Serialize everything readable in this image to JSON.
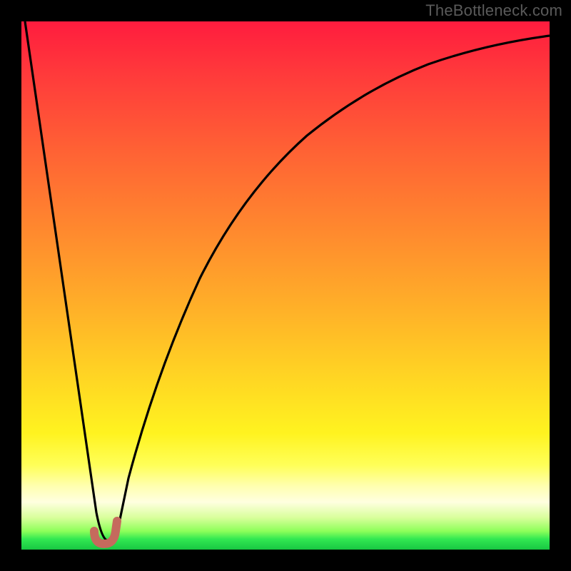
{
  "watermark": "TheBottleneck.com",
  "colors": {
    "background": "#000000",
    "gradient_top": "#ff1c3e",
    "gradient_mid": "#ffd723",
    "gradient_bottom": "#18c742",
    "curve": "#000000",
    "marker": "#c56a5d"
  },
  "chart_data": {
    "type": "line",
    "title": "",
    "xlabel": "",
    "ylabel": "",
    "xlim": [
      0,
      100
    ],
    "ylim": [
      0,
      100
    ],
    "series": [
      {
        "name": "bottleneck-curve",
        "x": [
          0,
          5,
          10,
          14,
          15,
          16,
          17,
          18,
          19,
          20,
          22,
          25,
          30,
          35,
          40,
          45,
          50,
          55,
          60,
          65,
          70,
          75,
          80,
          85,
          90,
          95,
          100
        ],
        "values": [
          100,
          67,
          34,
          7,
          2,
          0.5,
          0.5,
          0.8,
          2,
          5,
          14,
          28,
          46,
          59,
          68,
          75,
          80,
          84,
          87,
          89.5,
          91.5,
          93,
          94.2,
          95.2,
          96,
          96.6,
          97
        ]
      }
    ],
    "marker": {
      "name": "optimal-point",
      "shape": "J",
      "x_range": [
        14,
        18
      ],
      "y": 0.5
    }
  }
}
